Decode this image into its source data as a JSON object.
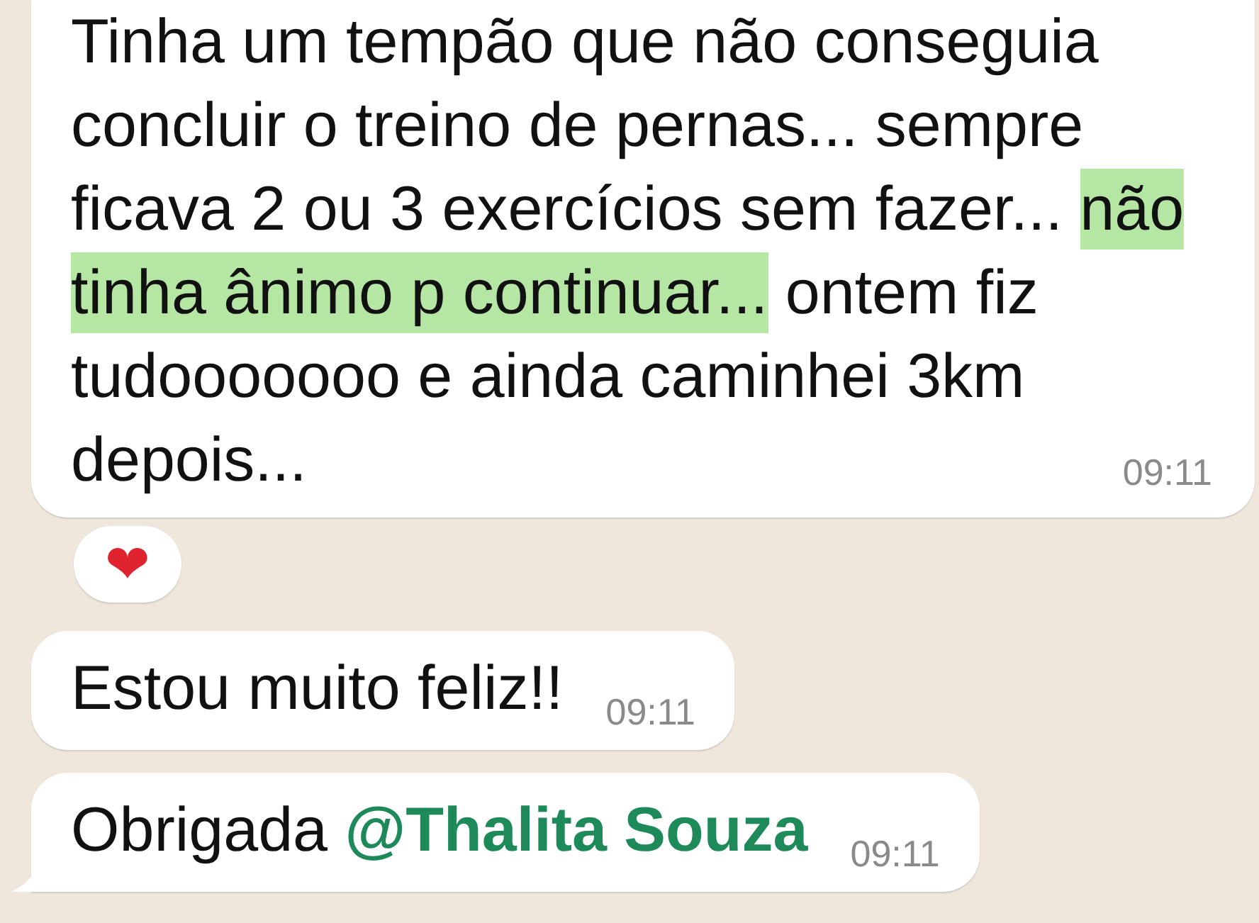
{
  "messages": [
    {
      "segments": [
        {
          "text": "Tinha um tempão que não conseguia concluir o treino de pernas... sempre ficava 2 ou 3 exercícios sem fazer... ",
          "kind": "plain"
        },
        {
          "text": "não tinha ânimo p continuar...",
          "kind": "highlight"
        },
        {
          "text": " ontem fiz tudooooooo e ainda caminhei 3km depois...",
          "kind": "plain"
        }
      ],
      "time": "09:11",
      "reaction": "❤",
      "tail": false
    },
    {
      "segments": [
        {
          "text": "Estou muito feliz!!",
          "kind": "plain"
        }
      ],
      "time": "09:11",
      "tail": false
    },
    {
      "segments": [
        {
          "text": "Obrigada ",
          "kind": "plain"
        },
        {
          "text": "@Thalita Souza",
          "kind": "mention"
        }
      ],
      "time": "09:11",
      "tail": true
    }
  ]
}
